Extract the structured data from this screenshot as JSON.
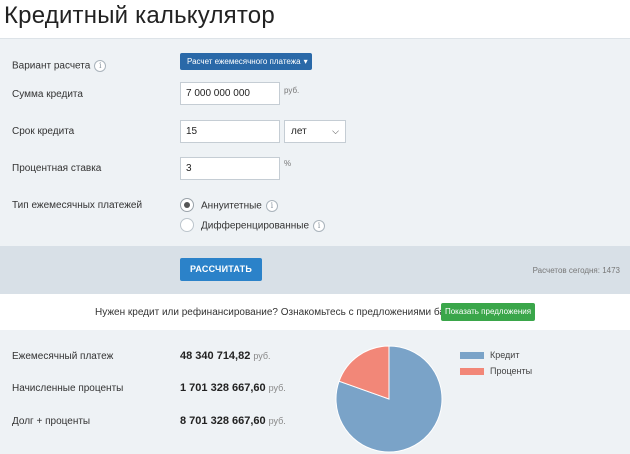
{
  "page": {
    "title": "Кредитный калькулятор"
  },
  "form": {
    "variant": {
      "label": "Вариант расчета",
      "button_label": "Расчет ежемесячного платежа",
      "chevron": "chevron-down-icon"
    },
    "amount": {
      "label": "Сумма кредита",
      "value": "7 000 000 000",
      "unit": "руб."
    },
    "term": {
      "label": "Срок кредита",
      "value": "15",
      "unit_selected": "лет",
      "chevron": "chevron-down-icon"
    },
    "rate": {
      "label": "Процентная ставка",
      "value": "3",
      "unit": "%"
    },
    "payment_type": {
      "label": "Тип ежемесячных платежей",
      "options": [
        {
          "label": "Аннуитетные",
          "checked": true
        },
        {
          "label": "Дифференцированные",
          "checked": false
        }
      ]
    },
    "info_icon_glyph": "i"
  },
  "actions": {
    "calculate_label": "РАССЧИТАТЬ",
    "today_count": "Расчетов сегодня: 1473"
  },
  "offer": {
    "text": "Нужен кредит или рефинансирование? Ознакомьтесь с предложениями банков",
    "button_label": "Показать предложения"
  },
  "results": {
    "items": [
      {
        "label": "Ежемесячный платеж",
        "value": "48 340 714,82",
        "unit": "руб."
      },
      {
        "label": "Начисленные проценты",
        "value": "1 701 328 667,60",
        "unit": "руб."
      },
      {
        "label": "Долг + проценты",
        "value": "8 701 328 667,60",
        "unit": "руб."
      }
    ]
  },
  "chart_data": {
    "type": "pie",
    "categories": [
      "Кредит",
      "Проценты"
    ],
    "values": [
      7000000000,
      1701328667.6
    ],
    "colors": [
      "#7aa3c8",
      "#f28778"
    ],
    "legend_position": "right"
  }
}
